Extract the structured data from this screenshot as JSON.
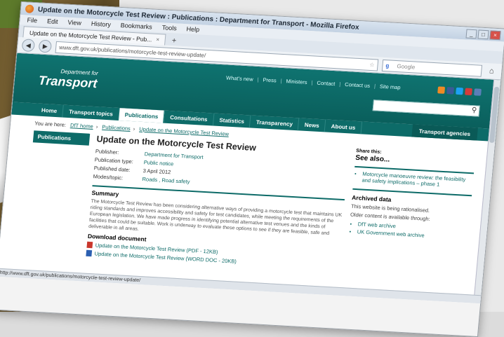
{
  "window": {
    "title": "Update on the Motorcycle Test Review : Publications : Department for Transport - Mozilla Firefox",
    "controls": [
      "_",
      "□",
      "×"
    ]
  },
  "menu": [
    "File",
    "Edit",
    "View",
    "History",
    "Bookmarks",
    "Tools",
    "Help"
  ],
  "tab": {
    "label": "Update on the Motorcycle Test Review - Pub...",
    "close": "×",
    "new": "+"
  },
  "nav": {
    "url": "www.dft.gov.uk/publications/motorcycle-test-review-update/",
    "search_placeholder": "Google",
    "back": "◀",
    "forward": "▶",
    "home": "⌂"
  },
  "site": {
    "logo_small": "Department for",
    "logo_big": "Transport",
    "toplinks": [
      "What's new",
      "Press",
      "Ministers",
      "Contact",
      "Contact us",
      "Site map"
    ],
    "social_colors": [
      "#f08a24",
      "#3b5998",
      "#1da1f2",
      "#d63b3b",
      "#5a7fb8"
    ],
    "topnav": [
      "Home",
      "Transport topics",
      "Publications",
      "Consultations",
      "Statistics",
      "Transparency",
      "News",
      "About us"
    ],
    "active_nav": "Publications",
    "agencies": "Transport agencies"
  },
  "breadcrumb": {
    "prefix": "You are here:",
    "items": [
      "DfT home",
      "Publications",
      "Update on the Motorcycle Test Review"
    ]
  },
  "leftnav": {
    "head": "Publications"
  },
  "article": {
    "title": "Update on the Motorcycle Test Review",
    "meta": [
      {
        "k": "Publisher:",
        "v": "Department for Transport"
      },
      {
        "k": "Publication type:",
        "v": "Public notice"
      },
      {
        "k": "Published date:",
        "v": "3 April 2012"
      },
      {
        "k": "Modes/topic:",
        "v": "Roads , Road safety"
      }
    ],
    "summary_heading": "Summary",
    "summary_text": "The Motorcycle Test Review has been considering alternative ways of providing a motorcycle test that maintains UK riding standards and improves accessibility and safety for test candidates, while meeting the requirements of the European legislation. We have made progress in identifying potential alternative test venues and the kinds of facilities that could be suitable. Work is underway to evaluate these options to see if they are feasible, safe and deliverable in all areas.",
    "download_heading": "Download document",
    "docs": [
      {
        "label": "Update on the Motorcycle Test Review (PDF - 12KB)",
        "kind": "pdf"
      },
      {
        "label": "Update on the Motorcycle Test Review (WORD DOC - 20KB)",
        "kind": "word"
      }
    ]
  },
  "sidebar": {
    "share": "Share this:",
    "see_also": "See also...",
    "see_also_items": [
      "Motorcycle manoeuvre review: the feasibility and safety implications – phase 1"
    ],
    "archived_heading": "Archived data",
    "archived_text1": "This website is being rationalised.",
    "archived_text2": "Older content is available through:",
    "archived_items": [
      "DfT web archive",
      "UK Government web archive"
    ]
  },
  "status": "http://www.dft.gov.uk/publications/motorcycle-test-review-update/"
}
